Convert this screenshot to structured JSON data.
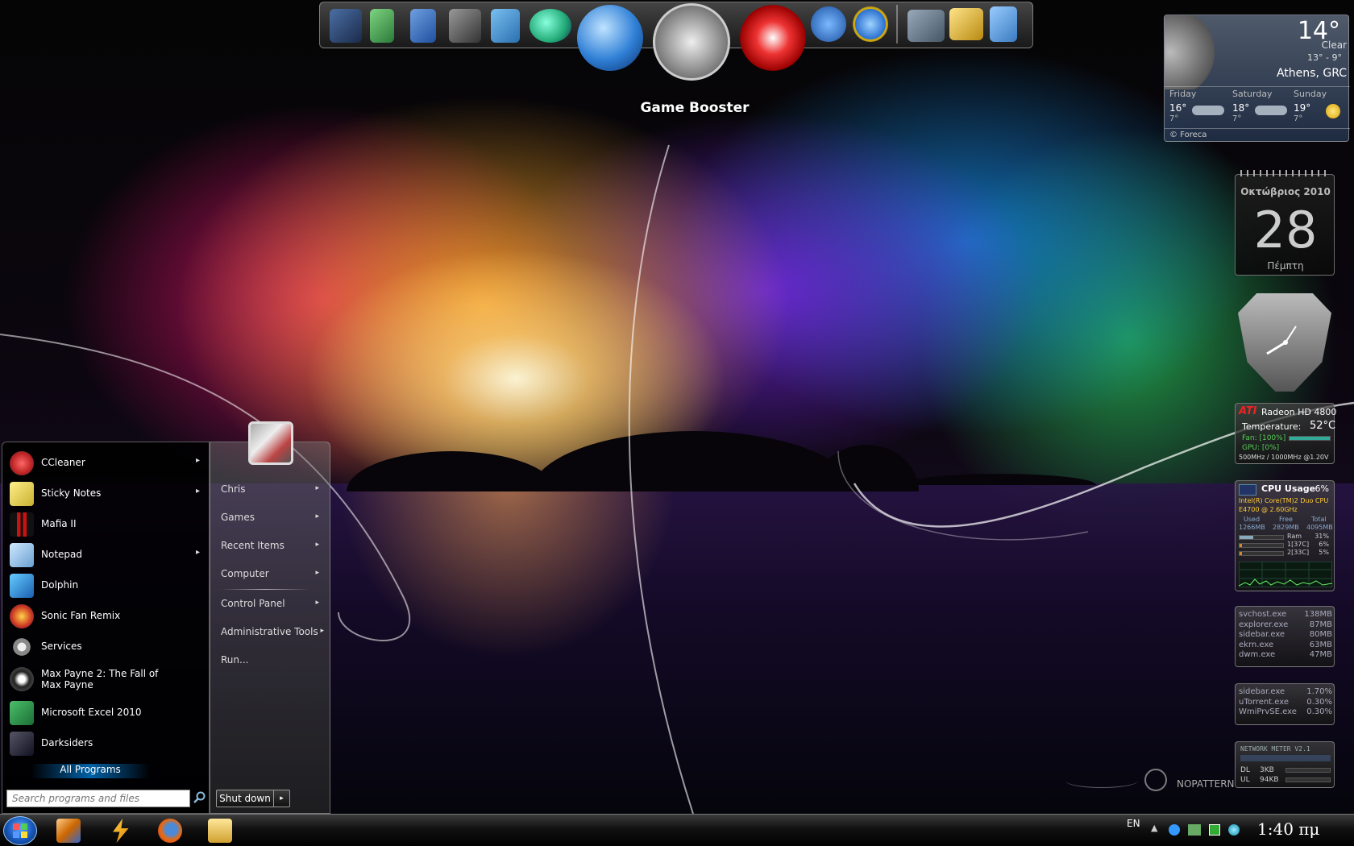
{
  "dock": {
    "hover_label": "Game Booster",
    "icons": [
      "computer-icon",
      "archive-icon",
      "media-player-icon",
      "video-editor-icon",
      "documents-icon",
      "network-globe-icon",
      "browser-globe-icon",
      "game-booster-gauge-icon",
      "swirl-app-icon",
      "yu-app-icon",
      "internet-explorer-icon",
      "laptop-icon",
      "tools-icon",
      "recycle-bin-icon"
    ]
  },
  "start_menu": {
    "user": "Chris",
    "programs": [
      {
        "label": "CCleaner",
        "submenu": true
      },
      {
        "label": "Sticky Notes",
        "submenu": true
      },
      {
        "label": "Mafia II",
        "submenu": false
      },
      {
        "label": "Notepad",
        "submenu": true
      },
      {
        "label": "Dolphin",
        "submenu": false
      },
      {
        "label": "Sonic Fan Remix",
        "submenu": false
      },
      {
        "label": "Services",
        "submenu": false
      },
      {
        "label": "Max Payne 2: The Fall of Max Payne",
        "submenu": false
      },
      {
        "label": "Microsoft Excel 2010",
        "submenu": false
      },
      {
        "label": "Darksiders",
        "submenu": false
      }
    ],
    "all_programs": "All Programs",
    "search_placeholder": "Search programs and files",
    "places": [
      {
        "label": "Chris",
        "submenu": true
      },
      {
        "label": "Games",
        "submenu": true
      },
      {
        "label": "Recent Items",
        "submenu": true
      },
      {
        "label": "Computer",
        "submenu": true
      },
      {
        "label": "Control Panel",
        "submenu": true
      },
      {
        "label": "Administrative Tools",
        "submenu": true
      },
      {
        "label": "Run...",
        "submenu": false
      }
    ],
    "shutdown": "Shut down",
    "arrow": "▸"
  },
  "weather": {
    "temp": "14°",
    "condition": "Clear",
    "range": "13° - 9°",
    "location": "Athens, GRC",
    "forecast": [
      {
        "day": "Friday",
        "high": "16°",
        "low": "7°"
      },
      {
        "day": "Saturday",
        "high": "18°",
        "low": "7°"
      },
      {
        "day": "Sunday",
        "high": "19°",
        "low": "7°"
      }
    ],
    "credit": "© Foreca"
  },
  "calendar": {
    "month": "Οκτώβριος 2010",
    "day": "28",
    "weekday": "Πέμπτη"
  },
  "gpu": {
    "brand": "ATI",
    "model": "Radeon HD 4800",
    "temp_label": "Temperature:",
    "temp": "52°C",
    "fan": "Fan: [100%]",
    "fan_fraction": 1.0,
    "gpu_load": "GPU: [0%]",
    "clocks": "500MHz / 1000MHz @1.20V"
  },
  "cpu": {
    "title": "CPU Usage",
    "usage": "6%",
    "model_line1": "Intel(R) Core(TM)2 Duo CPU",
    "model_line2": "E4700 @ 2.60GHz",
    "mem_headers": [
      "Used",
      "Free",
      "Total"
    ],
    "mem_values": [
      "1266MB",
      "2829MB",
      "4095MB"
    ],
    "rows": [
      {
        "label": "Ram",
        "value": "31%",
        "fraction": 0.31
      },
      {
        "label": "1[37C]",
        "value": "6%",
        "fraction": 0.06
      },
      {
        "label": "2[33C]",
        "value": "5%",
        "fraction": 0.05
      }
    ]
  },
  "processes_mem": [
    {
      "name": "svchost.exe",
      "value": "138MB"
    },
    {
      "name": "explorer.exe",
      "value": "87MB"
    },
    {
      "name": "sidebar.exe",
      "value": "80MB"
    },
    {
      "name": "ekrn.exe",
      "value": "63MB"
    },
    {
      "name": "dwm.exe",
      "value": "47MB"
    }
  ],
  "processes_cpu": [
    {
      "name": "sidebar.exe",
      "value": "1.70%"
    },
    {
      "name": "uTorrent.exe",
      "value": "0.30%"
    },
    {
      "name": "WmiPrvSE.exe",
      "value": "0.30%"
    }
  ],
  "network": {
    "title": "NETWORK METER V2.1",
    "dl_label": "DL",
    "dl": "3KB",
    "ul_label": "UL",
    "ul": "94KB"
  },
  "watermark": "NOPATTERN",
  "taskbar": {
    "lang": "EN",
    "clock": "1:40 πμ",
    "pinned": [
      "media-player-icon",
      "winamp-icon",
      "firefox-icon",
      "folder-icon"
    ]
  }
}
